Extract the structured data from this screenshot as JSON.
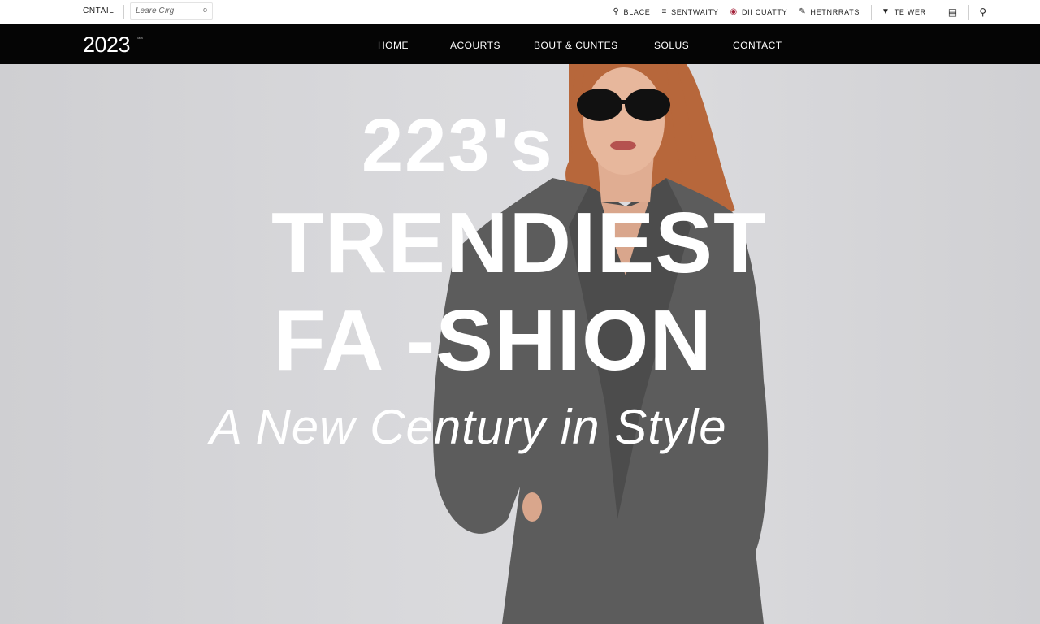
{
  "util_bar": {
    "contact_label": "CNTAIL",
    "search_value": "Leare Cırg",
    "search_clear": "o",
    "links": [
      {
        "icon": "search-icon",
        "label": "BLACE"
      },
      {
        "icon": "menu-icon",
        "label": "SENTWAITY"
      },
      {
        "icon": "pin-icon",
        "label": "DII CUATTY"
      },
      {
        "icon": "wand-icon",
        "label": "HETNRRATS"
      },
      {
        "icon": "filter-icon",
        "label": "TE WER"
      }
    ],
    "bookmark_icon": "bookmark-icon",
    "search_icon": "search-icon"
  },
  "nav": {
    "logo": "2023",
    "logo_sub": "ıaıa",
    "items": [
      "HOME",
      "ACOURTS",
      "BOUT & CUNTES",
      "SOLUS",
      "CONTACT"
    ]
  },
  "hero": {
    "line1": "223's",
    "line2": "TRENDIEST",
    "line3": "FA -SHION",
    "subtitle": "A New Century in Style"
  },
  "colors": {
    "nav_bg": "#050505",
    "hero_bg": "#d6d6d9",
    "coat": "#5c5c5c",
    "hair": "#b7673b"
  }
}
